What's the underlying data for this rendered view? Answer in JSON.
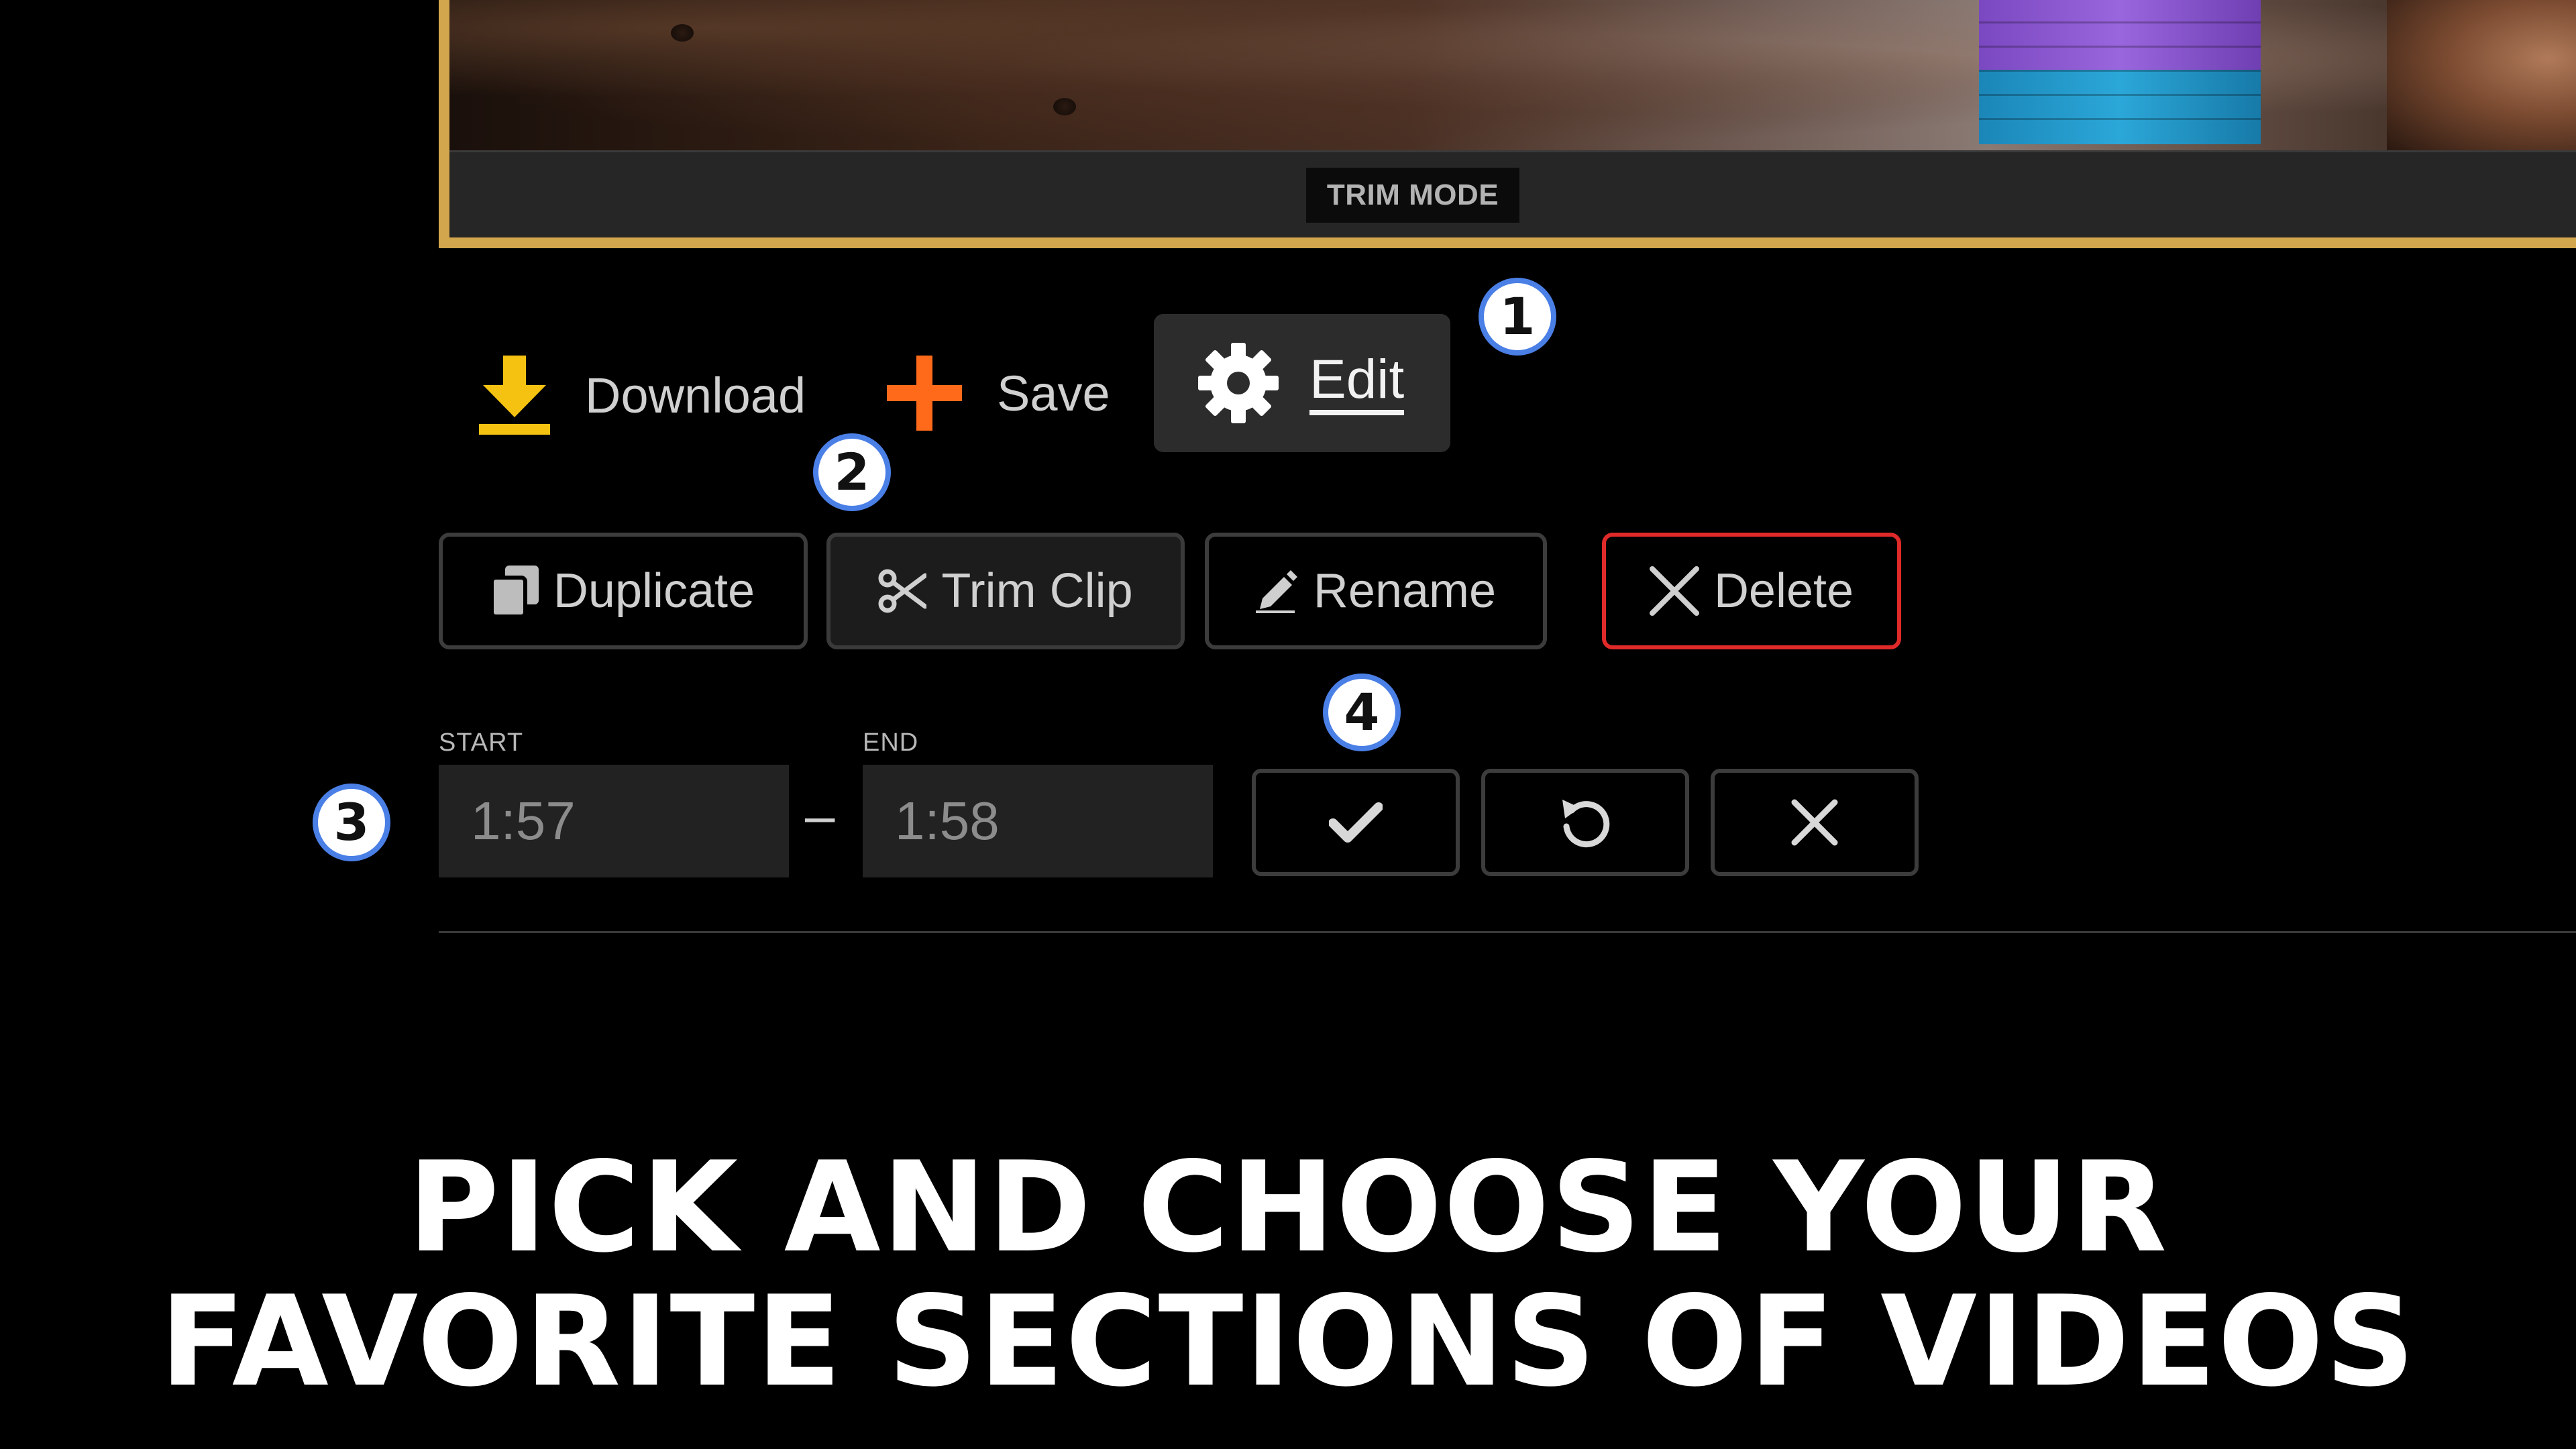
{
  "video": {
    "badge": "TRIM MODE"
  },
  "callouts": [
    "1",
    "2",
    "3",
    "4"
  ],
  "primary_actions": {
    "download_label": "Download",
    "save_label": "Save",
    "edit_label": "Edit"
  },
  "clip_actions": {
    "duplicate_label": "Duplicate",
    "trim_label": "Trim Clip",
    "rename_label": "Rename",
    "delete_label": "Delete"
  },
  "trim": {
    "start_label": "START",
    "start_value": "1:57",
    "end_label": "END",
    "end_value": "1:58",
    "separator": "–"
  },
  "headline": {
    "line1": "PICK AND CHOOSE YOUR",
    "line2": "FAVORITE SECTIONS OF VIDEOS"
  },
  "colors": {
    "frame_border": "#d2a64c",
    "download_icon": "#f5c211",
    "save_icon": "#ff6a1a",
    "delete_border": "#e02a2a",
    "callout_ring": "#4a7fe6"
  },
  "icons": {
    "download": "download-icon",
    "save": "plus-icon",
    "edit": "gear-icon",
    "duplicate": "copy-icon",
    "trim": "scissors-icon",
    "rename": "pencil-icon",
    "delete": "close-icon",
    "confirm": "check-icon",
    "reset": "undo-icon",
    "cancel": "close-icon"
  }
}
